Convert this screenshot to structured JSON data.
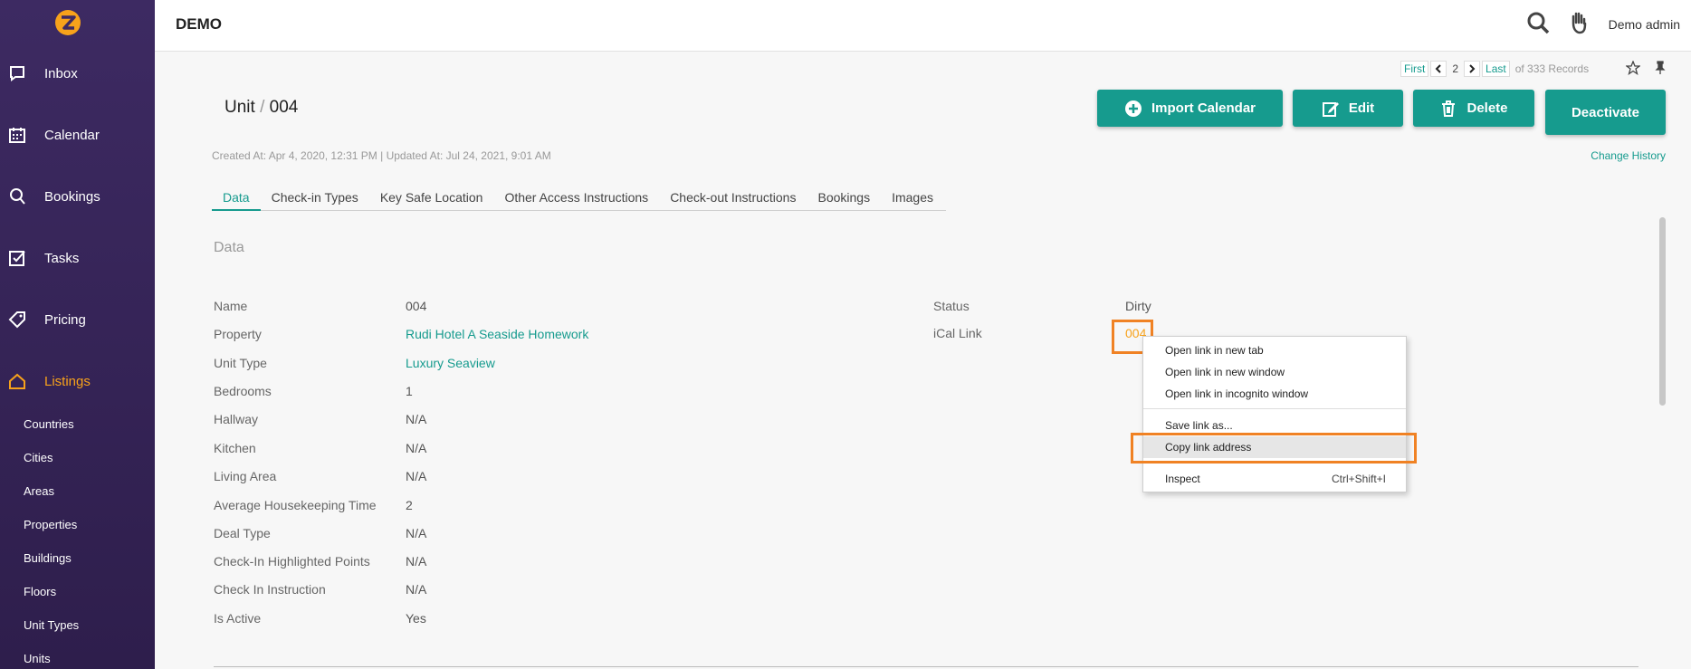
{
  "header": {
    "brand": "DEMO",
    "user": "Demo admin",
    "search_icon": "search-icon",
    "hand_icon": "hand-icon"
  },
  "sidebar": {
    "logo": "brand-logo-icon",
    "items": [
      {
        "label": "Inbox",
        "icon": "chat-icon"
      },
      {
        "label": "Calendar",
        "icon": "calendar-icon"
      },
      {
        "label": "Bookings",
        "icon": "bookings-icon"
      },
      {
        "label": "Tasks",
        "icon": "tasks-icon"
      },
      {
        "label": "Pricing",
        "icon": "tag-icon"
      },
      {
        "label": "Listings",
        "icon": "home-icon",
        "active": true
      }
    ],
    "sub_items": [
      "Countries",
      "Cities",
      "Areas",
      "Properties",
      "Buildings",
      "Floors",
      "Unit Types",
      "Units"
    ]
  },
  "pager": {
    "first": "First",
    "page": "2",
    "last": "Last",
    "total": "of 333 Records"
  },
  "title": {
    "entity": "Unit",
    "sep": "/",
    "name": "004"
  },
  "buttons": {
    "import": "Import Calendar",
    "edit": "Edit",
    "delete": "Delete",
    "deactivate": "Deactivate"
  },
  "meta": {
    "text": "Created At: Apr 4, 2020, 12:31 PM  | Updated At: Jul 24, 2021, 9:01 AM",
    "change_history": "Change History"
  },
  "tabs": [
    "Data",
    "Check-in Types",
    "Key Safe Location",
    "Other Access Instructions",
    "Check-out Instructions",
    "Bookings",
    "Images"
  ],
  "section": "Data",
  "fields_left": [
    {
      "label": "Name",
      "value": "004"
    },
    {
      "label": "Property",
      "value": "Rudi Hotel A Seaside Homework",
      "link": true
    },
    {
      "label": "Unit Type",
      "value": "Luxury Seaview",
      "link": true
    },
    {
      "label": "Bedrooms",
      "value": "1"
    },
    {
      "label": "Hallway",
      "value": "N/A"
    },
    {
      "label": "Kitchen",
      "value": "N/A"
    },
    {
      "label": "Living Area",
      "value": "N/A"
    },
    {
      "label": "Average Housekeeping Time",
      "value": "2"
    },
    {
      "label": "Deal Type",
      "value": "N/A"
    },
    {
      "label": "Check-In Highlighted Points",
      "value": "N/A"
    },
    {
      "label": "Check In Instruction",
      "value": "N/A"
    },
    {
      "label": "Is Active",
      "value": "Yes"
    }
  ],
  "fields_right": [
    {
      "label": "Status",
      "value": "Dirty"
    },
    {
      "label": "iCal Link",
      "value": "004"
    }
  ],
  "context_menu": {
    "open_new_tab": "Open link in new tab",
    "open_new_window": "Open link in new window",
    "open_incognito": "Open link in incognito window",
    "save_link": "Save link as...",
    "copy_link": "Copy link address",
    "inspect": "Inspect",
    "inspect_shortcut": "Ctrl+Shift+I"
  },
  "colors": {
    "accent": "#169b8e",
    "sidebar": "#3d2a62",
    "highlight": "#f08224",
    "active_nav": "#f7a21b"
  }
}
